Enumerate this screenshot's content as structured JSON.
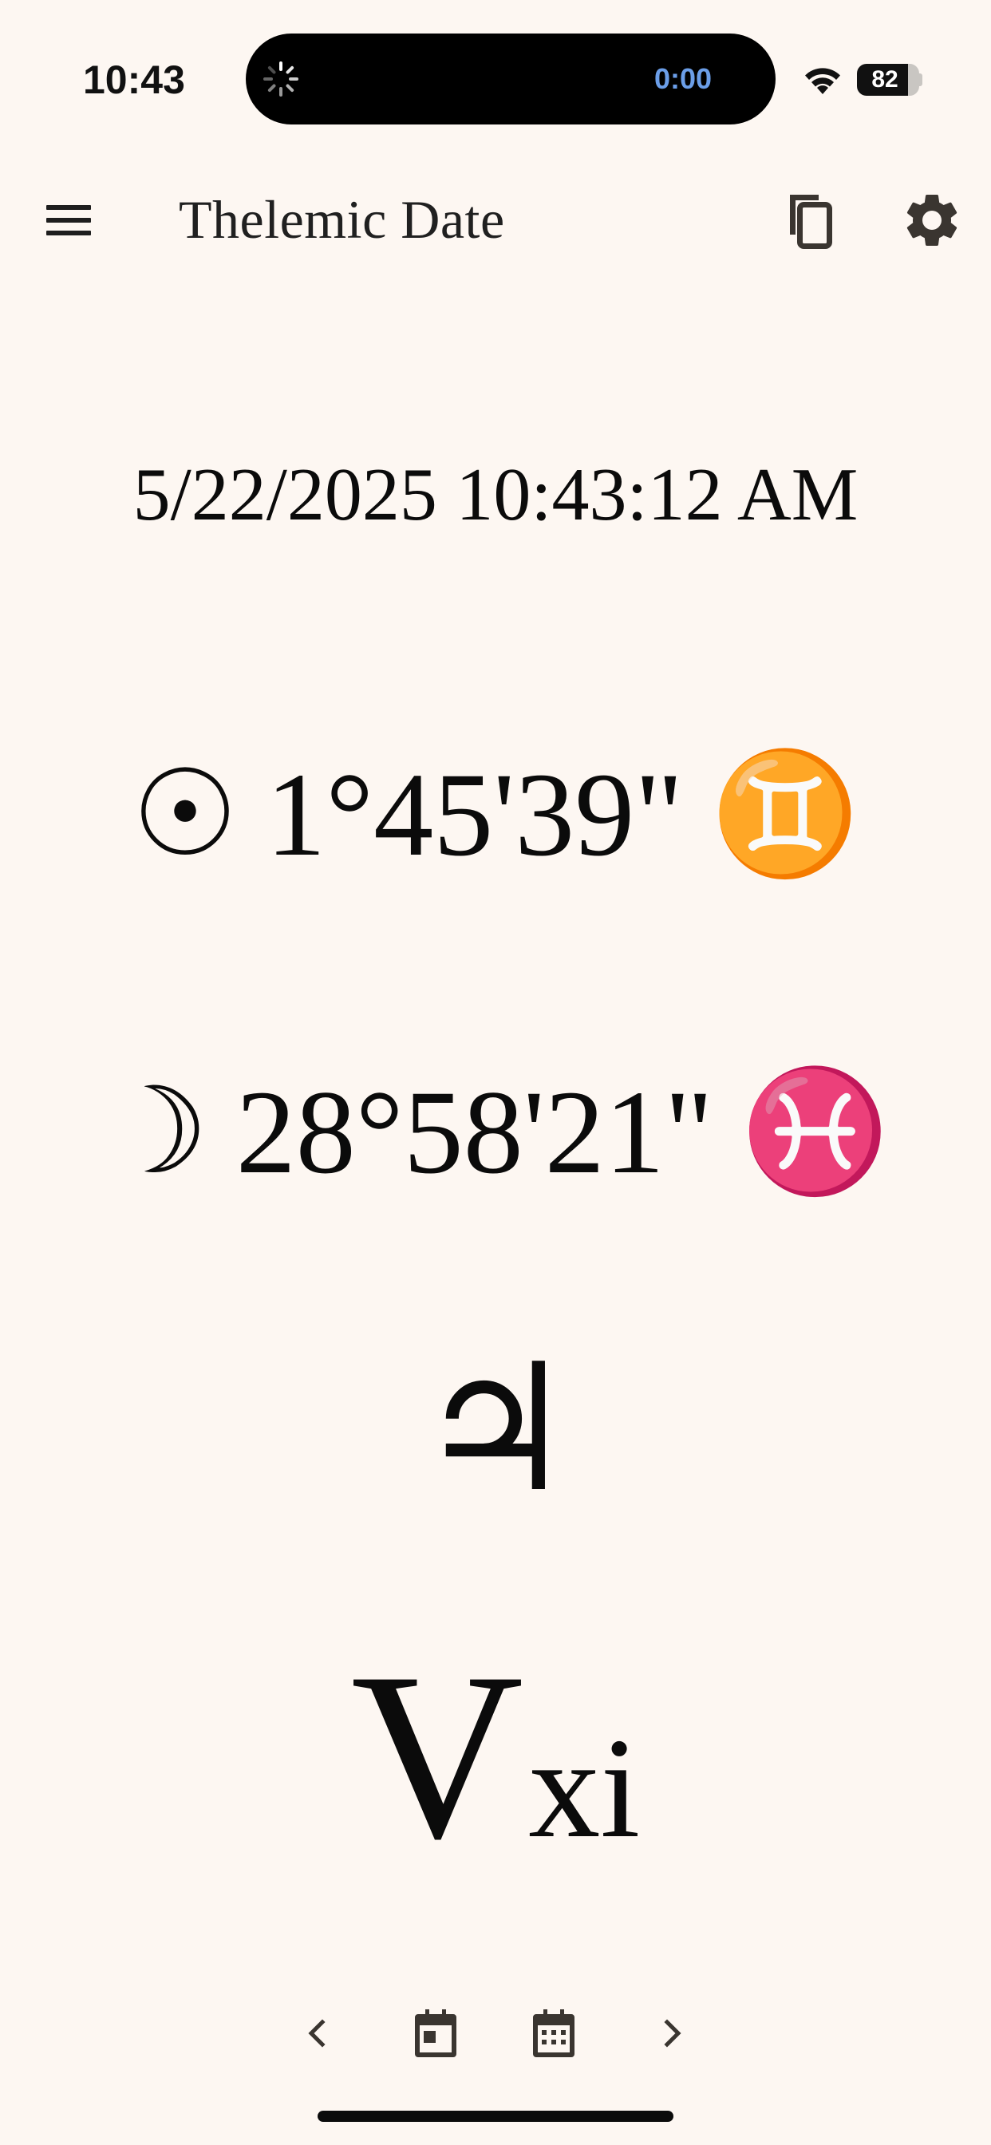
{
  "status_bar": {
    "time": "10:43",
    "island_timer": "0:00",
    "battery_level": "82",
    "icons": [
      "wifi-icon",
      "battery-icon",
      "spinner-icon"
    ]
  },
  "app_bar": {
    "title": "Thelemic Date",
    "icons": [
      "menu-icon",
      "copy-icon",
      "gear-icon"
    ]
  },
  "main": {
    "date_time": "5/22/2025 10:43:12 AM",
    "sun": {
      "glyph": "☉",
      "position": "1°45'39\"",
      "sign_glyph": "♊"
    },
    "moon": {
      "glyph": "☽",
      "position": "28°58'21\"",
      "sign_glyph": "♓"
    },
    "day_planet_glyph": "♃",
    "year": {
      "major": "V",
      "minor": "xi"
    }
  },
  "bottom_nav": {
    "icons": [
      "chevron-left-icon",
      "calendar-today-icon",
      "calendar-icon",
      "chevron-right-icon"
    ]
  },
  "colors": {
    "background": "#fdf7f2",
    "text": "#0b0b0b",
    "icon": "#3a3530",
    "timer_accent": "#6b9ee8"
  }
}
